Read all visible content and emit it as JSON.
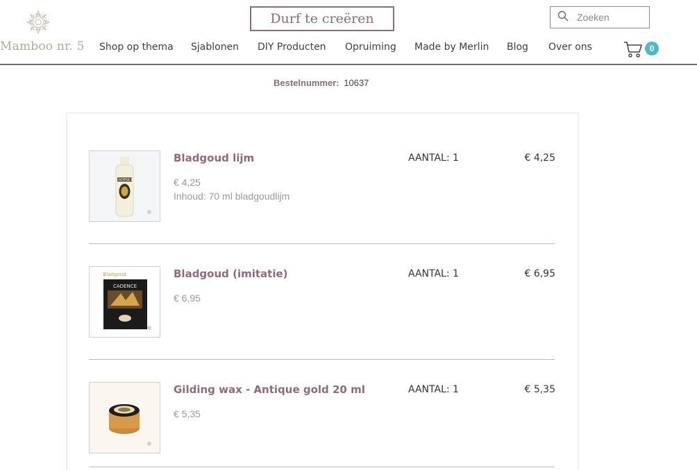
{
  "brand": {
    "name": "Mamboo nr. 5"
  },
  "header": {
    "cta_label": "Durf te creëren",
    "search_placeholder": "Zoeken",
    "cart_count": "0"
  },
  "nav": [
    {
      "label": "Shop op thema"
    },
    {
      "label": "Sjablonen"
    },
    {
      "label": "DIY Producten"
    },
    {
      "label": "Opruiming"
    },
    {
      "label": "Made by Merlin"
    },
    {
      "label": "Blog"
    },
    {
      "label": "Over ons"
    }
  ],
  "order": {
    "label": "Bestelnummer:",
    "number": "10637"
  },
  "items": [
    {
      "name": "Bladgoud lijm",
      "price": "€ 4,25",
      "description": "Inhoud: 70 ml bladgoudlijm",
      "quantity": "AANTAL: 1",
      "total": "€ 4,25",
      "thumb_label": "CADENCE"
    },
    {
      "name": "Bladgoud (imitatie)",
      "price": "€ 6,95",
      "description": "",
      "quantity": "AANTAL: 1",
      "total": "€ 6,95",
      "thumb_label": "CADENCE",
      "thumb_top_label": "Bladgoud"
    },
    {
      "name": "Gilding wax - Antique gold 20 ml",
      "price": "€ 5,35",
      "description": "",
      "quantity": "AANTAL: 1",
      "total": "€ 5,35"
    }
  ],
  "colors": {
    "accent": "#8f6b79",
    "badge": "#4fb9c8",
    "logo": "#b5a79a"
  }
}
